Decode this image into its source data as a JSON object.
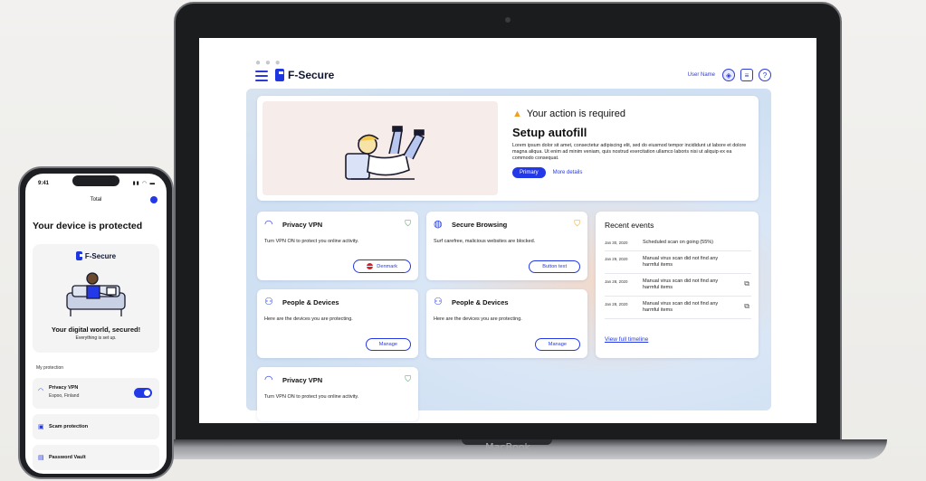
{
  "app": {
    "brand": "F-Secure",
    "user_name": "User Name",
    "colors": {
      "accent": "#2339e8",
      "warning": "#f0a020"
    }
  },
  "action": {
    "warning_text": "Your action is required",
    "title": "Setup autofill",
    "description": "Lorem ipsum dolor sit amet, consectetur adipiscing elit, sed do eiusmod tempor incididunt ut labore et dolore magna aliqua. Ut enim ad minim veniam, quis nostrud exercitation ullamco laboris nisi ut aliquip ex ea commodo consequat.",
    "primary_label": "Primary",
    "more_label": "More details"
  },
  "features": [
    {
      "title": "Privacy VPN",
      "desc": "Turn VPN ON to protect you online activity.",
      "button": "Denmark",
      "status_icon": "shield-check-icon"
    },
    {
      "title": "Secure Browsing",
      "desc": "Surf carefree, malicious websites are blocked.",
      "button": "Button text",
      "status_icon": "shield-warning-icon"
    },
    {
      "title": "People & Devices",
      "desc": "Here are the devices you are protecting.",
      "button": "Manage"
    },
    {
      "title": "People & Devices",
      "desc": "Here are the devices you are protecting.",
      "button": "Manage"
    },
    {
      "title": "Privacy VPN",
      "desc": "Turn VPN ON to protect you online activity.",
      "status_icon": "shield-check-icon"
    }
  ],
  "events": {
    "title": "Recent events",
    "items": [
      {
        "date": "Jan 30, 2020",
        "text": "Scheduled scan on going (55%)"
      },
      {
        "date": "Jan 29, 2020",
        "text": "Manual virus scan did not find any harmful items"
      },
      {
        "date": "Jan 28, 2020",
        "text": "Manual virus scan did not find any harmful items"
      },
      {
        "date": "Jan 28, 2020",
        "text": "Manual virus scan did not find any harmful items"
      }
    ],
    "link": "View full timeline"
  },
  "laptop": {
    "label": "MacBook"
  },
  "phone": {
    "time": "9:41",
    "title": "Total",
    "protected": "Your device is protected",
    "brand": "F-Secure",
    "world": "Your digital world, secured!",
    "setup": "Everything is set up.",
    "my_protection": "My protection",
    "vpn_label": "Privacy VPN",
    "vpn_sub": "Espoo, Finland",
    "scam_label": "Scam protection",
    "vault_label": "Password Vault"
  }
}
